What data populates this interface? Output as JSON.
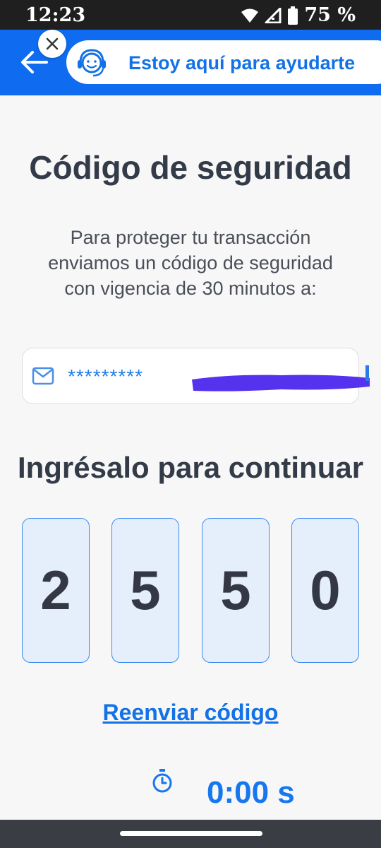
{
  "status_bar": {
    "time": "12:23",
    "battery": "75 %"
  },
  "header": {
    "helper_text": "Estoy aquí para ayudarte"
  },
  "main": {
    "title": "Código de seguridad",
    "description": "Para proteger tu transacción enviamos un código de seguridad con vigencia de 30 minutos a:",
    "email_masked": "*********",
    "subtitle": "Ingrésalo para continuar",
    "code_digits": [
      "2",
      "5",
      "5",
      "0"
    ],
    "resend_label": "Reenviar código",
    "timer": "0:00 s"
  },
  "colors": {
    "brand_blue": "#0f6cf0",
    "text_dark": "#343b48",
    "redaction": "#5533ee"
  }
}
